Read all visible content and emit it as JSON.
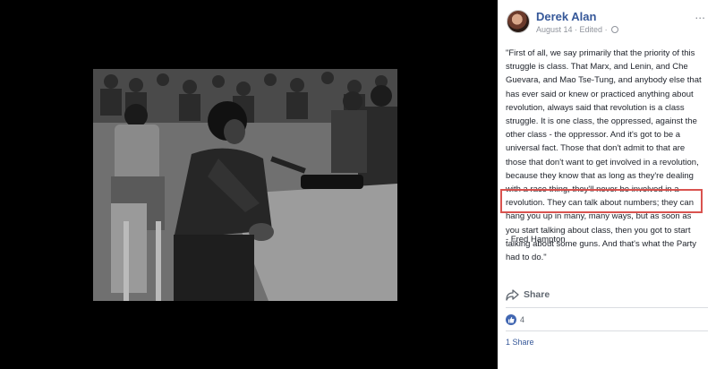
{
  "post": {
    "author": "Derek Alan",
    "date": "August 14",
    "edited": "Edited",
    "more_label": "...",
    "text_lines": [
      "\"First of all, we say primarily that the priority of this",
      "struggle is class. That Marx, and Lenin, and Che",
      "Guevara, and Mao Tse-Tung, and anybody else that",
      "has ever said or knew or practiced anything about",
      "revolution, always said that revolution is a class",
      "struggle. It is one class, the oppressed, against the",
      "other class - the oppressor. And it's got to be a",
      "universal fact. Those that don't admit to that are",
      "those that don't want to get involved in a revolution,",
      "because they know that as long as they're dealing",
      "with a race thing, they'll never be involved in a",
      "revolution. They can talk about numbers; they can",
      "hang you up in many, many ways, but as soon as",
      "you start talking about class, then you got to start",
      "talking about some guns. And that's what the Party",
      "had to do.\""
    ],
    "attribution": "- Fred Hampton"
  },
  "actions": {
    "share_label": "Share"
  },
  "reactions": {
    "likes": "4",
    "shares": "1 Share"
  },
  "colors": {
    "link": "#365899",
    "highlight": "#d9534f",
    "like_blue": "#4267b2"
  }
}
